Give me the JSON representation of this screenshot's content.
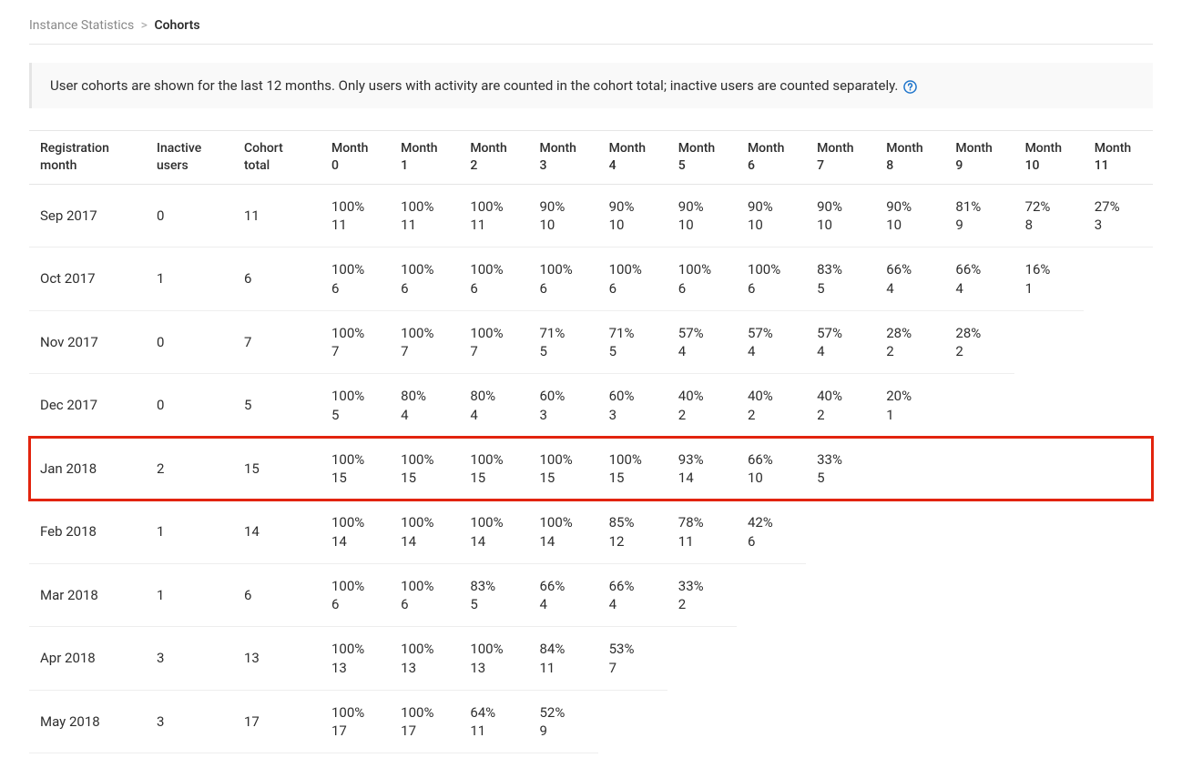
{
  "breadcrumb": {
    "parent": "Instance Statistics",
    "separator": ">",
    "current": "Cohorts"
  },
  "info": {
    "text": "User cohorts are shown for the last 12 months. Only users with activity are counted in the cohort total; inactive users are counted separately.",
    "help_label": "help"
  },
  "table": {
    "headers": [
      "Registration month",
      "Inactive users",
      "Cohort total",
      "Month 0",
      "Month 1",
      "Month 2",
      "Month 3",
      "Month 4",
      "Month 5",
      "Month 6",
      "Month 7",
      "Month 8",
      "Month 9",
      "Month 10",
      "Month 11"
    ],
    "rows": [
      {
        "label": "Sep 2017",
        "inactive": "0",
        "total": "11",
        "highlight": false,
        "months": [
          {
            "pct": "100%",
            "n": "11"
          },
          {
            "pct": "100%",
            "n": "11"
          },
          {
            "pct": "100%",
            "n": "11"
          },
          {
            "pct": "90%",
            "n": "10"
          },
          {
            "pct": "90%",
            "n": "10"
          },
          {
            "pct": "90%",
            "n": "10"
          },
          {
            "pct": "90%",
            "n": "10"
          },
          {
            "pct": "90%",
            "n": "10"
          },
          {
            "pct": "90%",
            "n": "10"
          },
          {
            "pct": "81%",
            "n": "9"
          },
          {
            "pct": "72%",
            "n": "8"
          },
          {
            "pct": "27%",
            "n": "3"
          }
        ]
      },
      {
        "label": "Oct 2017",
        "inactive": "1",
        "total": "6",
        "highlight": false,
        "months": [
          {
            "pct": "100%",
            "n": "6"
          },
          {
            "pct": "100%",
            "n": "6"
          },
          {
            "pct": "100%",
            "n": "6"
          },
          {
            "pct": "100%",
            "n": "6"
          },
          {
            "pct": "100%",
            "n": "6"
          },
          {
            "pct": "100%",
            "n": "6"
          },
          {
            "pct": "100%",
            "n": "6"
          },
          {
            "pct": "83%",
            "n": "5"
          },
          {
            "pct": "66%",
            "n": "4"
          },
          {
            "pct": "66%",
            "n": "4"
          },
          {
            "pct": "16%",
            "n": "1"
          }
        ]
      },
      {
        "label": "Nov 2017",
        "inactive": "0",
        "total": "7",
        "highlight": false,
        "months": [
          {
            "pct": "100%",
            "n": "7"
          },
          {
            "pct": "100%",
            "n": "7"
          },
          {
            "pct": "100%",
            "n": "7"
          },
          {
            "pct": "71%",
            "n": "5"
          },
          {
            "pct": "71%",
            "n": "5"
          },
          {
            "pct": "57%",
            "n": "4"
          },
          {
            "pct": "57%",
            "n": "4"
          },
          {
            "pct": "57%",
            "n": "4"
          },
          {
            "pct": "28%",
            "n": "2"
          },
          {
            "pct": "28%",
            "n": "2"
          }
        ]
      },
      {
        "label": "Dec 2017",
        "inactive": "0",
        "total": "5",
        "highlight": false,
        "months": [
          {
            "pct": "100%",
            "n": "5"
          },
          {
            "pct": "80%",
            "n": "4"
          },
          {
            "pct": "80%",
            "n": "4"
          },
          {
            "pct": "60%",
            "n": "3"
          },
          {
            "pct": "60%",
            "n": "3"
          },
          {
            "pct": "40%",
            "n": "2"
          },
          {
            "pct": "40%",
            "n": "2"
          },
          {
            "pct": "40%",
            "n": "2"
          },
          {
            "pct": "20%",
            "n": "1"
          }
        ]
      },
      {
        "label": "Jan 2018",
        "inactive": "2",
        "total": "15",
        "highlight": true,
        "months": [
          {
            "pct": "100%",
            "n": "15"
          },
          {
            "pct": "100%",
            "n": "15"
          },
          {
            "pct": "100%",
            "n": "15"
          },
          {
            "pct": "100%",
            "n": "15"
          },
          {
            "pct": "100%",
            "n": "15"
          },
          {
            "pct": "93%",
            "n": "14"
          },
          {
            "pct": "66%",
            "n": "10"
          },
          {
            "pct": "33%",
            "n": "5"
          }
        ]
      },
      {
        "label": "Feb 2018",
        "inactive": "1",
        "total": "14",
        "highlight": false,
        "months": [
          {
            "pct": "100%",
            "n": "14"
          },
          {
            "pct": "100%",
            "n": "14"
          },
          {
            "pct": "100%",
            "n": "14"
          },
          {
            "pct": "100%",
            "n": "14"
          },
          {
            "pct": "85%",
            "n": "12"
          },
          {
            "pct": "78%",
            "n": "11"
          },
          {
            "pct": "42%",
            "n": "6"
          }
        ]
      },
      {
        "label": "Mar 2018",
        "inactive": "1",
        "total": "6",
        "highlight": false,
        "months": [
          {
            "pct": "100%",
            "n": "6"
          },
          {
            "pct": "100%",
            "n": "6"
          },
          {
            "pct": "83%",
            "n": "5"
          },
          {
            "pct": "66%",
            "n": "4"
          },
          {
            "pct": "66%",
            "n": "4"
          },
          {
            "pct": "33%",
            "n": "2"
          }
        ]
      },
      {
        "label": "Apr 2018",
        "inactive": "3",
        "total": "13",
        "highlight": false,
        "months": [
          {
            "pct": "100%",
            "n": "13"
          },
          {
            "pct": "100%",
            "n": "13"
          },
          {
            "pct": "100%",
            "n": "13"
          },
          {
            "pct": "84%",
            "n": "11"
          },
          {
            "pct": "53%",
            "n": "7"
          }
        ]
      },
      {
        "label": "May 2018",
        "inactive": "3",
        "total": "17",
        "highlight": false,
        "months": [
          {
            "pct": "100%",
            "n": "17"
          },
          {
            "pct": "100%",
            "n": "17"
          },
          {
            "pct": "64%",
            "n": "11"
          },
          {
            "pct": "52%",
            "n": "9"
          }
        ]
      }
    ]
  }
}
